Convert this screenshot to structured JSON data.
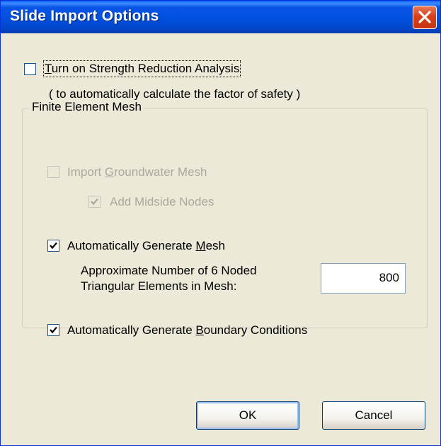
{
  "window": {
    "title": "Slide Import Options",
    "close_glyph": "close-icon"
  },
  "strength_reduction": {
    "label_accel": "T",
    "label_rest": "urn on Strength Reduction Analysis",
    "checked": false,
    "note": "( to automatically calculate the factor of safety )"
  },
  "mesh_group": {
    "legend": "Finite Element Mesh",
    "import_groundwater": {
      "label_pre": "Import ",
      "label_accel": "G",
      "label_post": "roundwater Mesh",
      "checked": false,
      "enabled": false
    },
    "add_midside": {
      "label": "Add Midside Nodes",
      "checked": true,
      "enabled": false
    },
    "auto_mesh": {
      "label_pre": "Automatically Generate ",
      "label_accel": "M",
      "label_post": "esh",
      "checked": true
    },
    "elements_label_line1": "Approximate Number of 6 Noded",
    "elements_label_line2": "Triangular Elements in Mesh:",
    "elements_value": "800",
    "auto_boundary": {
      "label_pre": "Automatically Generate ",
      "label_accel": "B",
      "label_post": "oundary Conditions",
      "checked": true
    }
  },
  "buttons": {
    "ok": "OK",
    "cancel": "Cancel"
  },
  "colors": {
    "title_bar": "#0050e0",
    "dialog_bg": "#ece9d8",
    "close_button": "#d9401b",
    "disabled_text": "#aca899"
  }
}
